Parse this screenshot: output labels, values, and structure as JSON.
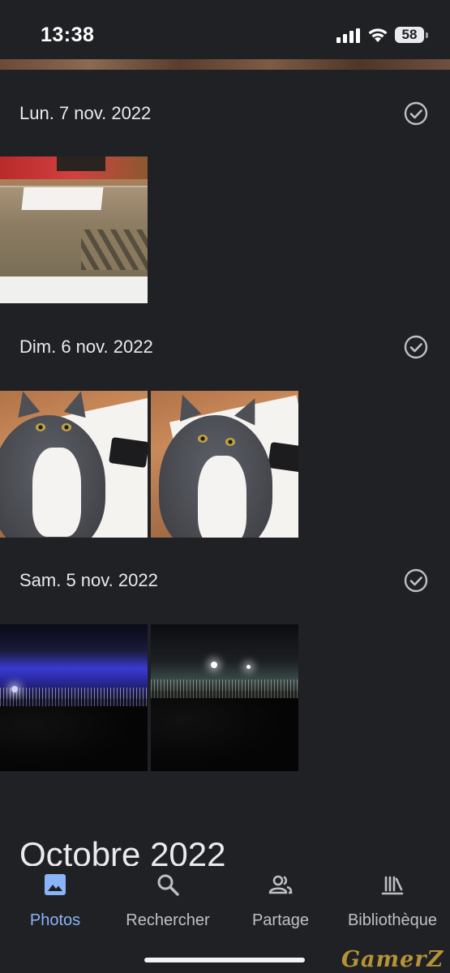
{
  "status_bar": {
    "time": "13:38",
    "battery_level": "58",
    "icons": [
      "signal-icon",
      "wifi-icon",
      "battery-icon"
    ]
  },
  "sections": [
    {
      "date": "Lun. 7 nov. 2022",
      "photos": [
        "cardboard-box-photo"
      ]
    },
    {
      "date": "Dim. 6 nov. 2022",
      "photos": [
        "cat-photo",
        "cat-photo"
      ]
    },
    {
      "date": "Sam. 5 nov. 2022",
      "photos": [
        "concert-photo",
        "concert-photo"
      ]
    }
  ],
  "month_header": "Octobre 2022",
  "bottom_nav": {
    "items": [
      {
        "label": "Photos",
        "icon": "photos-icon",
        "active": true
      },
      {
        "label": "Rechercher",
        "icon": "search-icon",
        "active": false
      },
      {
        "label": "Partage",
        "icon": "people-icon",
        "active": false
      },
      {
        "label": "Bibliothèque",
        "icon": "library-icon",
        "active": false
      }
    ]
  },
  "watermark": "GamerZ",
  "colors": {
    "background": "#202124",
    "text": "#e8eaed",
    "accent": "#8ab4f8",
    "nav_inactive": "#bdc1c6"
  }
}
